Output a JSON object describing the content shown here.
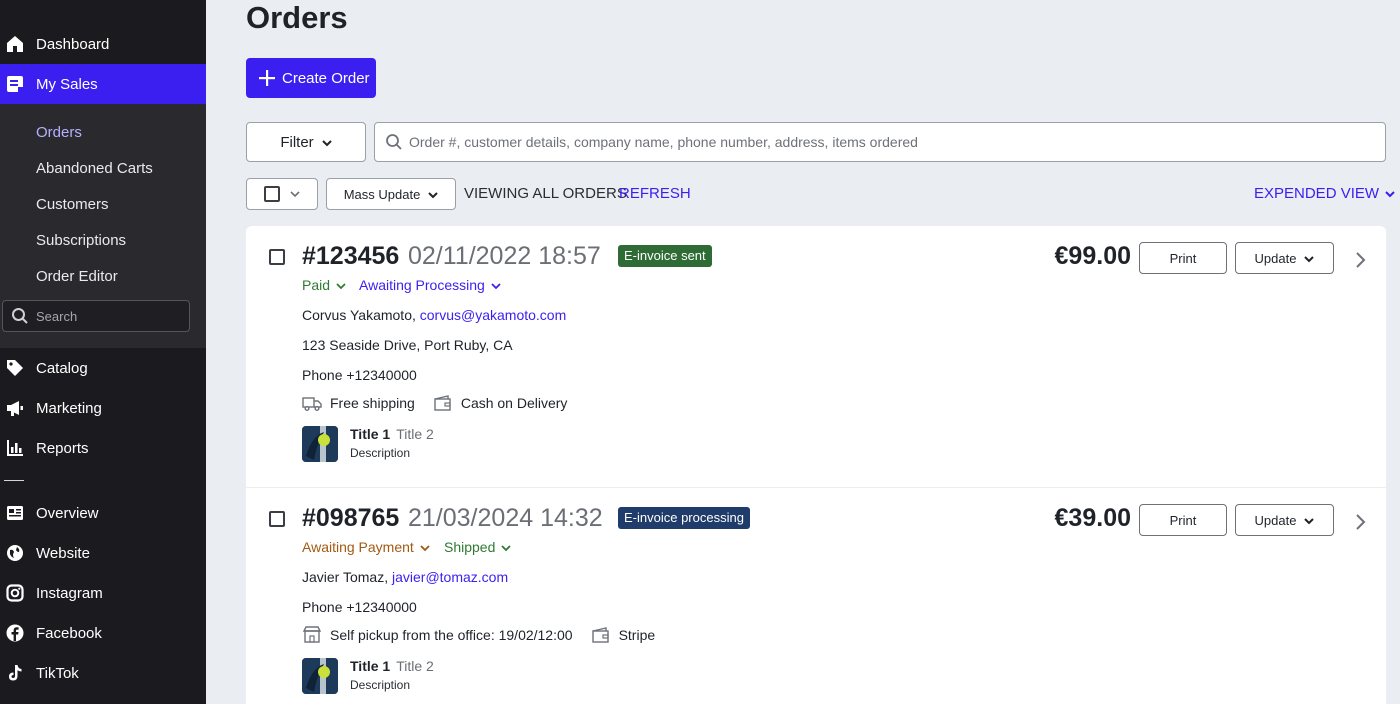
{
  "sidebar": {
    "top_items": [
      {
        "label": "Dashboard",
        "icon": "home-icon"
      },
      {
        "label": "My Sales",
        "icon": "sales-icon"
      }
    ],
    "sub_items": [
      "Orders",
      "Abandoned Carts",
      "Customers",
      "Subscriptions",
      "Order Editor"
    ],
    "search_placeholder": "Search",
    "mid_items": [
      {
        "label": "Catalog",
        "icon": "tag-icon"
      },
      {
        "label": "Marketing",
        "icon": "megaphone-icon"
      },
      {
        "label": "Reports",
        "icon": "bar-chart-icon"
      }
    ],
    "channel_items": [
      {
        "label": "Overview",
        "icon": "overview-icon"
      },
      {
        "label": "Website",
        "icon": "globe-icon"
      },
      {
        "label": "Instagram",
        "icon": "instagram-icon"
      },
      {
        "label": "Facebook",
        "icon": "facebook-icon"
      },
      {
        "label": "TikTok",
        "icon": "tiktok-icon"
      }
    ],
    "accent": "#3a1ff0"
  },
  "page": {
    "title": "Orders",
    "create_label": "Create Order",
    "filter_label": "Filter",
    "search_placeholder": "Order #, customer details, company name, phone number, address, items ordered",
    "mass_update_label": "Mass Update",
    "viewing_label": "VIEWING ALL ORDERS",
    "refresh_label": "REFRESH",
    "view_label": "EXPENDED VIEW"
  },
  "orders": [
    {
      "number": "#123456",
      "date": "02/11/2022 18:57",
      "badge": "E-invoice sent",
      "payment_status": "Paid",
      "fulfillment_status": "Awaiting Processing",
      "customer_name": "Corvus Yakamoto,",
      "customer_email": "corvus@yakamoto.com",
      "address": "123 Seaside Drive, Port Ruby, CA",
      "phone": "Phone +12340000",
      "shipping": "Free shipping",
      "payment_method": "Cash on Delivery",
      "item_title": "Title 1",
      "item_title2": "Title 2",
      "item_desc": "Description",
      "price": "€99.00",
      "print_label": "Print",
      "update_label": "Update"
    },
    {
      "number": "#098765",
      "date": "21/03/2024 14:32",
      "badge": "E-invoice processing",
      "payment_status": "Awaiting Payment",
      "fulfillment_status": "Shipped",
      "customer_name": "Javier Tomaz,",
      "customer_email": "javier@tomaz.com",
      "phone": "Phone +12340000",
      "shipping": "Self pickup from the office: 19/02/12:00",
      "payment_method": "Stripe",
      "item_title": "Title 1",
      "item_title2": "Title 2",
      "item_desc": "Description",
      "price": "€39.00",
      "print_label": "Print",
      "update_label": "Update"
    }
  ]
}
